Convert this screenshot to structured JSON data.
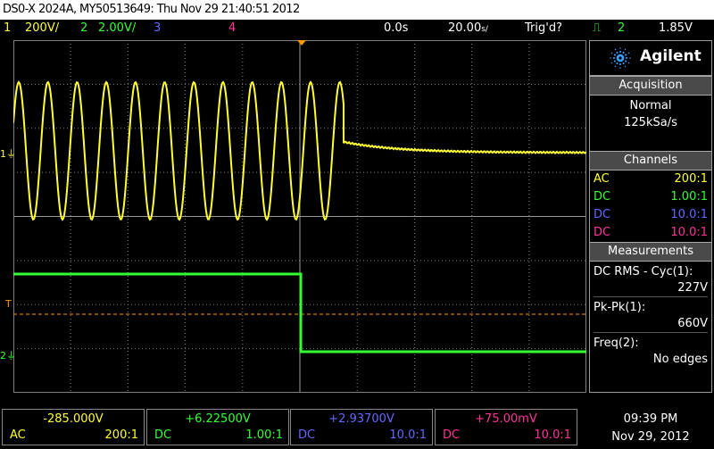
{
  "title": "DS0-X 2024A, MY50513649: Thu Nov 29 21:40:51 2012",
  "status": {
    "ch1_num": "1",
    "ch1_scale": "200V/",
    "ch2_num": "2",
    "ch2_scale": "2.00V/",
    "ch3_num": "3",
    "ch4_num": "4",
    "time_offset": "0.0s",
    "timebase": "20.00",
    "timebase_unit": "s/",
    "trig_state": "Trig'd?",
    "trig_src": "2",
    "trig_level": "1.85V"
  },
  "brand": {
    "name": "Agilent",
    "icon": "agilent-spark-icon"
  },
  "acquisition": {
    "header": "Acquisition",
    "mode": "Normal",
    "rate": "125kSa/s"
  },
  "channels": {
    "header": "Channels",
    "rows": [
      {
        "coupling": "AC",
        "probe": "200:1",
        "color": "#ffff33"
      },
      {
        "coupling": "DC",
        "probe": "1.00:1",
        "color": "#33ff33"
      },
      {
        "coupling": "DC",
        "probe": "10.0:1",
        "color": "#6666ff"
      },
      {
        "coupling": "DC",
        "probe": "10.0:1",
        "color": "#ff3399"
      }
    ]
  },
  "measurements": {
    "header": "Measurements",
    "items": [
      {
        "label": "DC RMS - Cyc(1):",
        "value": "227V"
      },
      {
        "label": "Pk-Pk(1):",
        "value": "660V"
      },
      {
        "label": "Freq(2):",
        "value": "No edges"
      }
    ]
  },
  "markers": {
    "ch1": "1",
    "trigger": "T",
    "ch2": "2"
  },
  "bottom": [
    {
      "offset": "-285.000V",
      "coupling": "AC",
      "probe": "200:1",
      "color": "#ffff33"
    },
    {
      "offset": "+6.22500V",
      "coupling": "DC",
      "probe": "1.00:1",
      "color": "#33ff33"
    },
    {
      "offset": "+2.93700V",
      "coupling": "DC",
      "probe": "10.0:1",
      "color": "#6666ff"
    },
    {
      "offset": "+75.00mV",
      "coupling": "DC",
      "probe": "10.0:1",
      "color": "#ff3399"
    }
  ],
  "clock": {
    "time": "09:39 PM",
    "date": "Nov 29, 2012"
  },
  "colors": {
    "ch1": "#ffff33",
    "ch2": "#33ff33",
    "ch3": "#6666ff",
    "ch4": "#ff3399",
    "trigger": "#ff9900",
    "grid": "#808080"
  }
}
